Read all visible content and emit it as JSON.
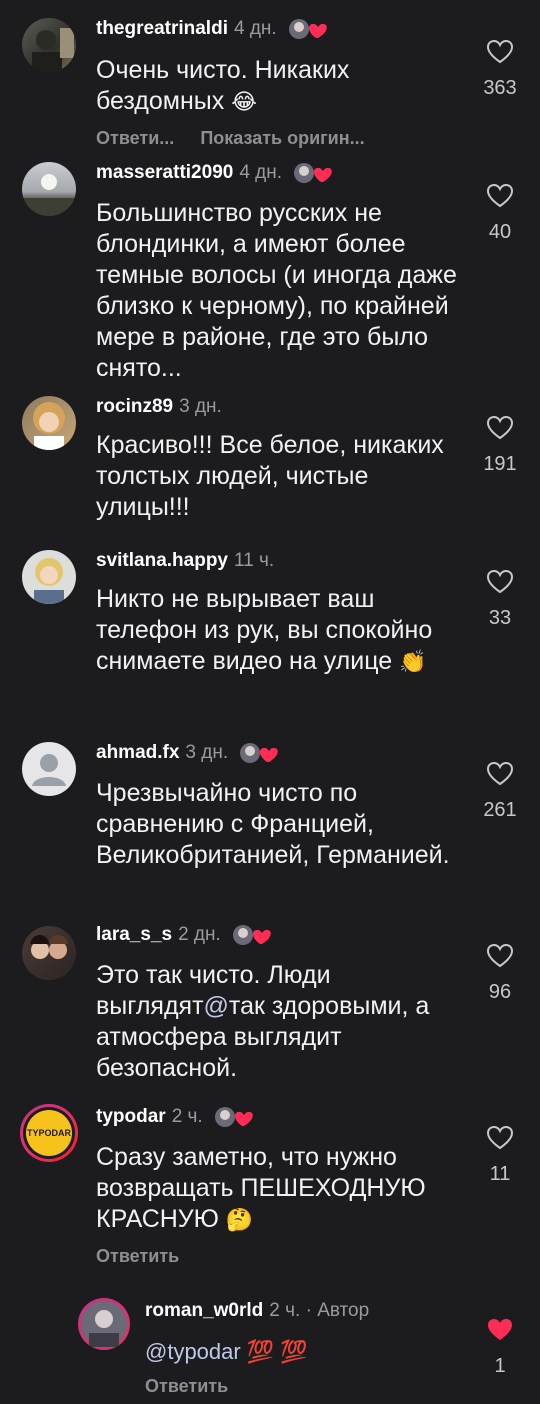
{
  "comments": [
    {
      "user": "thegreatrinaldi",
      "time": "4 дн.",
      "text": "Очень чисто. Никаких бездомных",
      "emoji": "😂",
      "likes": "363",
      "actions": [
        "Ответи...",
        "Показать оригин..."
      ]
    },
    {
      "user": "masseratti2090",
      "time": "4 дн.",
      "text": "Большинство русских не блондинки, а имеют более темные волосы (и иногда даже близко к черному), по крайней мере в районе, где это было снято...",
      "likes": "40"
    },
    {
      "user": "rocinz89",
      "time": "3 дн.",
      "text": "Красиво!!! Все белое, никаких толстых людей, чистые улицы!!!",
      "likes": "191"
    },
    {
      "user": "svitlana.happy",
      "time": "11 ч.",
      "text": "Никто не вырывает ваш телефон из рук, вы спокойно снимаете видео на улице",
      "emoji": "👏",
      "likes": "33"
    },
    {
      "user": "ahmad.fx",
      "time": "3 дн.",
      "text": "Чрезвычайно чисто по сравнению с Францией, Великобританией, Германией.",
      "likes": "261"
    },
    {
      "user": "lara_s_s",
      "time": "2 дн.",
      "text_pre": "Это так чисто. Люди выглядят",
      "mention": "@",
      "text_post": "так здоровыми, а атмосфера выглядит безопасной.",
      "likes": "96"
    },
    {
      "user": "typodar",
      "time": "2 ч.",
      "text": "Сразу заметно, что нужно возвращать ПЕШЕХОДНУЮ КРАСНУЮ",
      "emoji": "🤔",
      "likes": "11",
      "action": "Ответить",
      "avatar_text": "TYPODAR"
    }
  ],
  "reply": {
    "user": "roman_w0rld",
    "time": "2 ч.",
    "author_label": "Автор",
    "mention": "@typodar",
    "emoji": "💯 💯",
    "likes": "1",
    "action": "Ответить"
  },
  "colors": {
    "background": "#1c1c1f",
    "liked_heart": "#ff2d55",
    "typodar_avatar": "#f6c21c"
  }
}
